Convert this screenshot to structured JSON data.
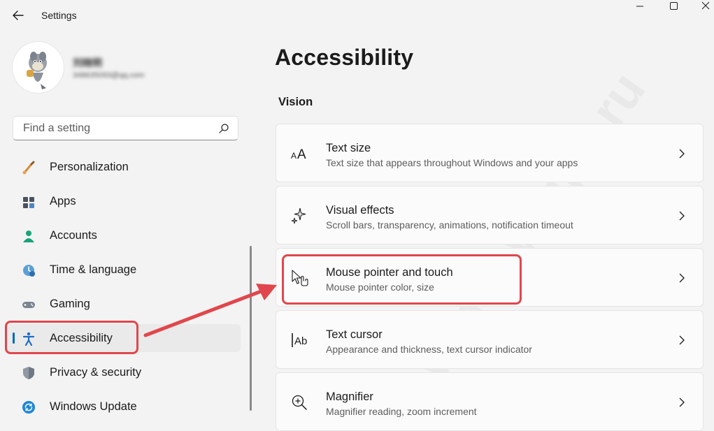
{
  "window": {
    "title": "Settings",
    "buttons": {
      "minimize": "minimize-icon",
      "maximize": "maximize-icon",
      "close": "close-icon"
    }
  },
  "profile": {
    "name": "刘晓明",
    "email": "348635093@qq.com"
  },
  "search": {
    "placeholder": "Find a setting"
  },
  "sidebar": {
    "items": [
      {
        "label": "Personalization",
        "icon": "brush-icon"
      },
      {
        "label": "Apps",
        "icon": "apps-icon"
      },
      {
        "label": "Accounts",
        "icon": "person-icon"
      },
      {
        "label": "Time & language",
        "icon": "clock-globe-icon"
      },
      {
        "label": "Gaming",
        "icon": "gamepad-icon"
      },
      {
        "label": "Accessibility",
        "icon": "accessibility-icon",
        "selected": true
      },
      {
        "label": "Privacy & security",
        "icon": "shield-icon"
      },
      {
        "label": "Windows Update",
        "icon": "update-icon"
      }
    ]
  },
  "main": {
    "title": "Accessibility",
    "section": "Vision",
    "cards": [
      {
        "title": "Text size",
        "subtitle": "Text size that appears throughout Windows and your apps",
        "icon": "text-size-icon"
      },
      {
        "title": "Visual effects",
        "subtitle": "Scroll bars, transparency, animations, notification timeout",
        "icon": "sparkle-icon"
      },
      {
        "title": "Mouse pointer and touch",
        "subtitle": "Mouse pointer color, size",
        "icon": "pointer-touch-icon"
      },
      {
        "title": "Text cursor",
        "subtitle": "Appearance and thickness, text cursor indicator",
        "icon": "text-cursor-icon"
      },
      {
        "title": "Magnifier",
        "subtitle": "Magnifier reading, zoom increment",
        "icon": "magnifier-icon"
      }
    ]
  },
  "watermark": "windowsips.ru",
  "colors": {
    "accent": "#0067c0",
    "annotation": "#e0474c",
    "background": "#f3f3f3",
    "card": "#fbfbfb"
  }
}
